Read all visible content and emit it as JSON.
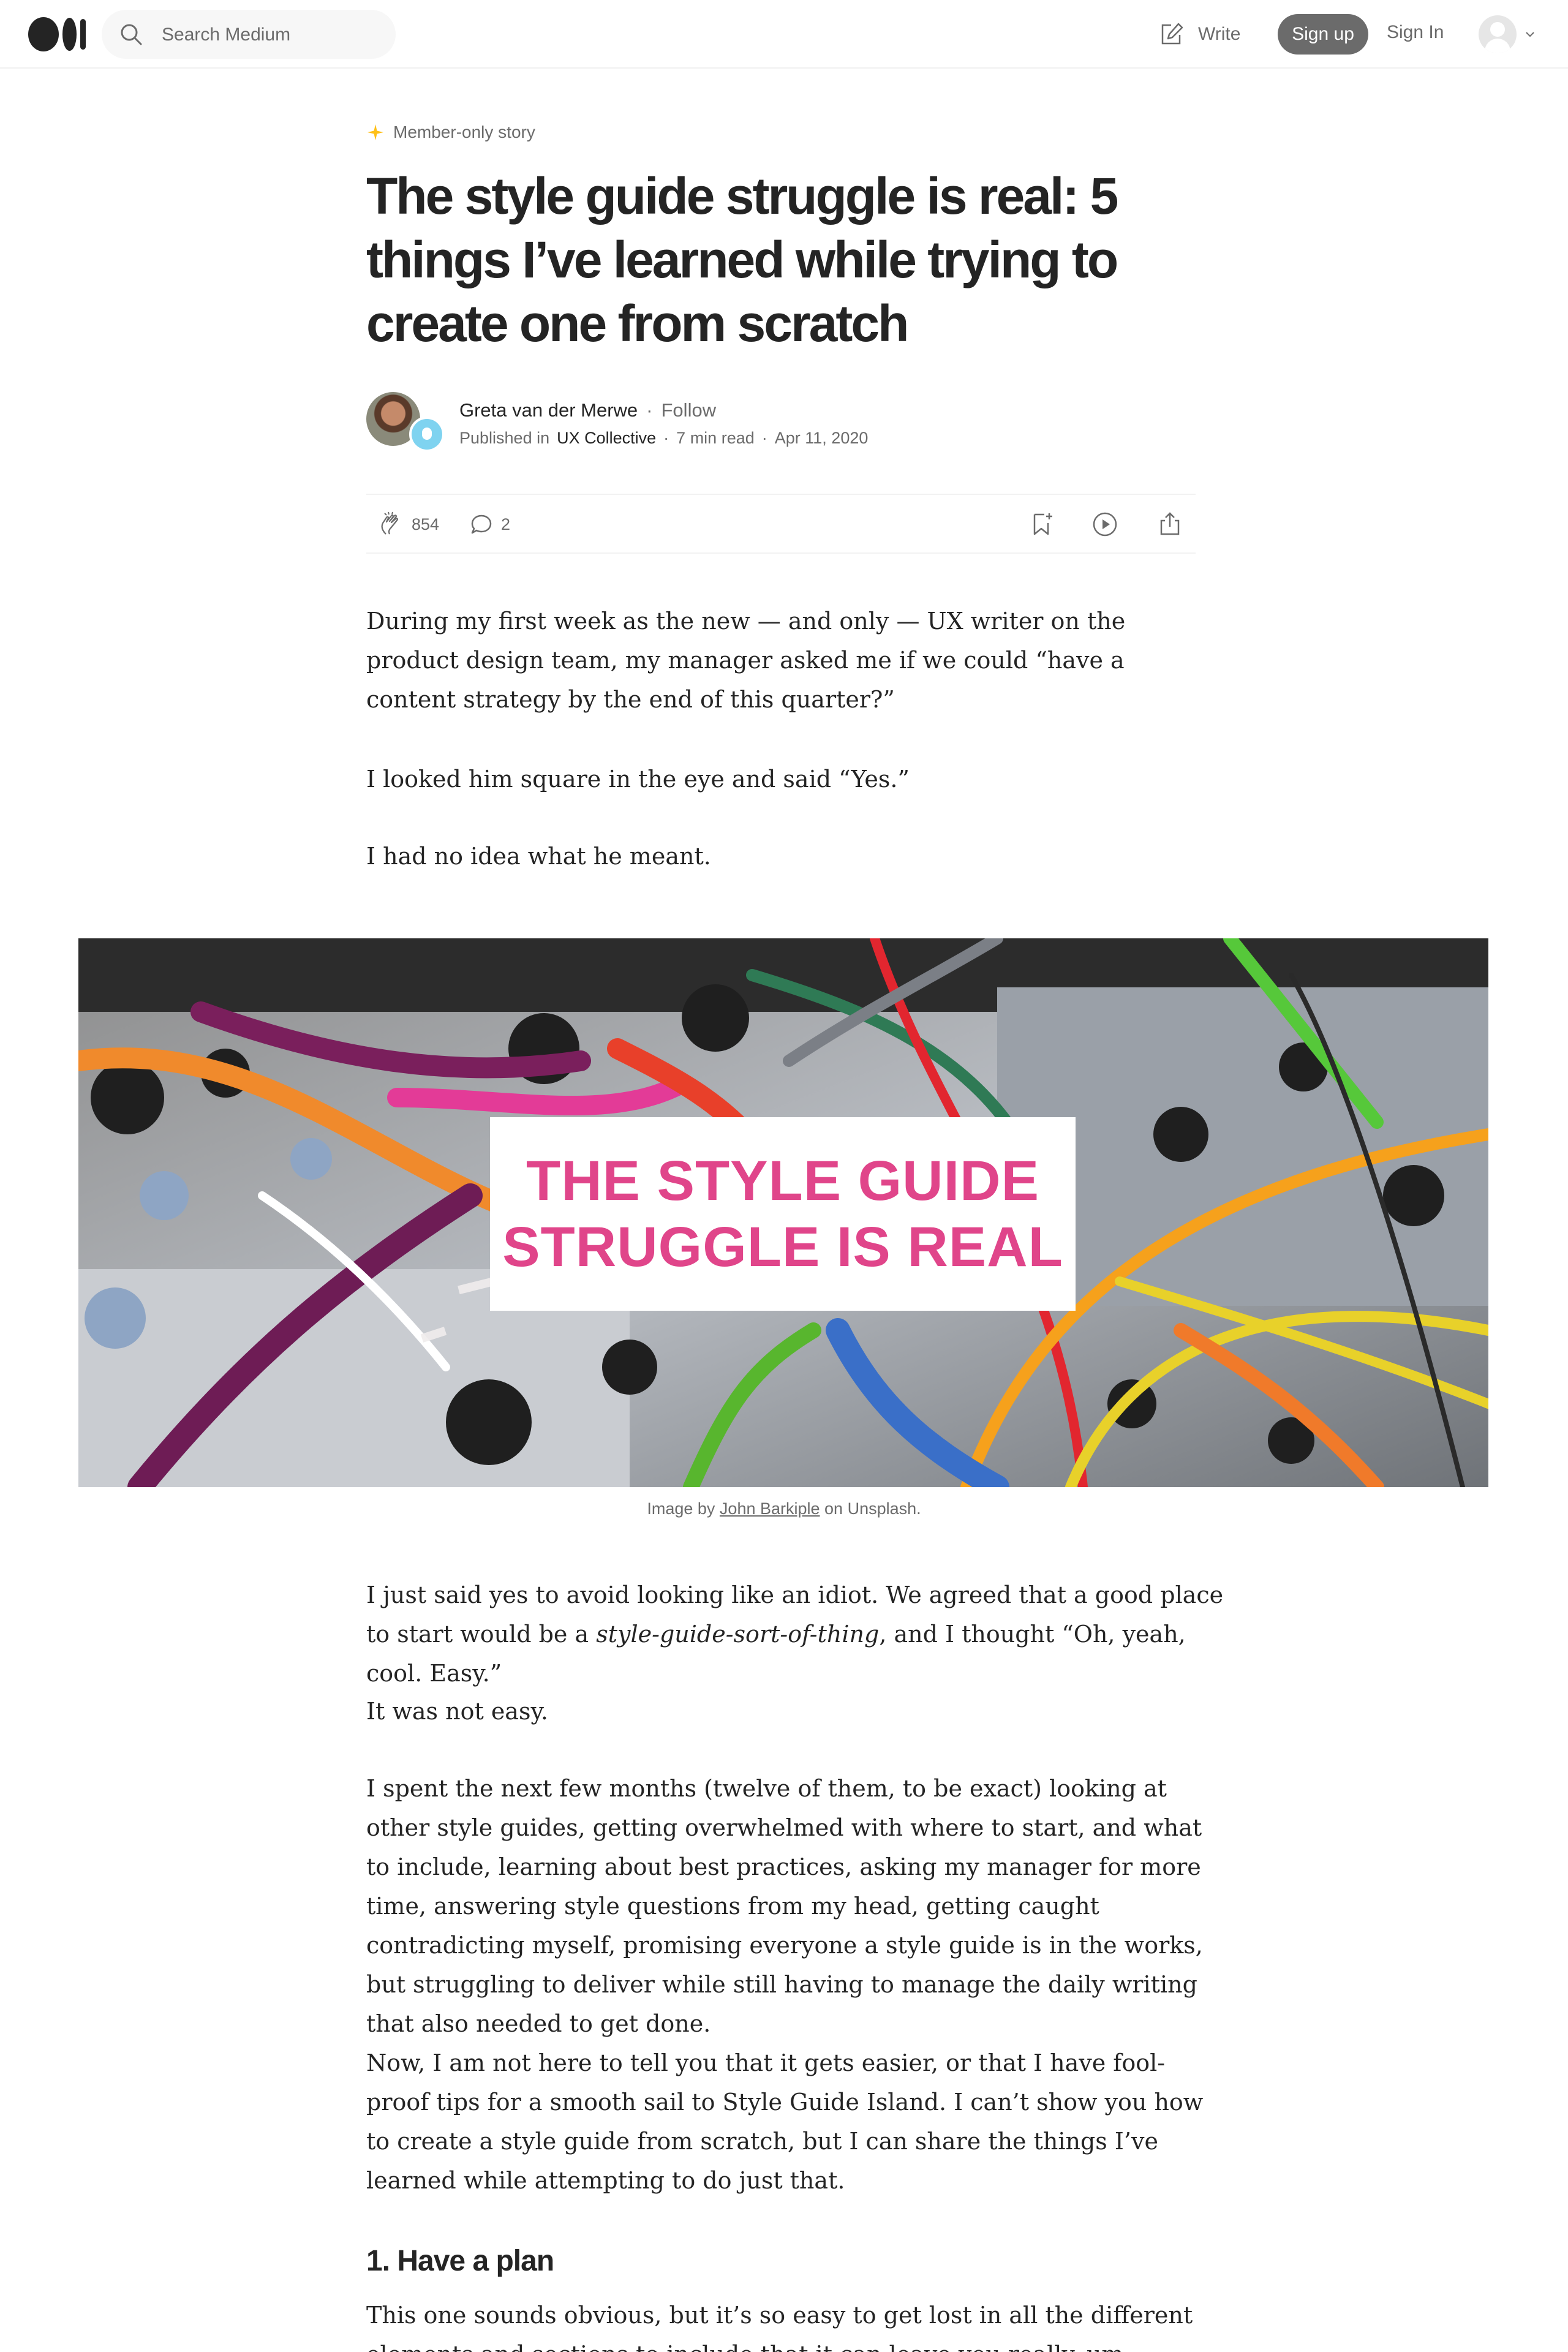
{
  "nav": {
    "search_placeholder": "Search Medium",
    "write_label": "Write",
    "signup_label": "Sign up",
    "signin_label": "Sign In"
  },
  "article": {
    "member_label": "Member-only story",
    "title": "The style guide struggle is real: 5 things I’ve learned while trying to create one from scratch",
    "author": "Greta van der Merwe",
    "follow_label": "Follow",
    "published_in_label": "Published in",
    "publication": "UX Collective",
    "read_time": "7 min read",
    "date": "Apr 11, 2020",
    "claps": "854",
    "responses": "2",
    "paragraphs": {
      "p1": "During my first week as the new — and only — UX writer on the product design team, my manager asked me if we could “have a content strategy by the end of this quarter?”",
      "p2": "I looked him square in the eye and said “Yes.”",
      "p3": "I had no idea what he meant.",
      "p4_a": "I just said yes to avoid looking like an idiot. We agreed that a good place to start would be a ",
      "p4_em": "style-guide-sort-of-thing",
      "p4_b": ", and I thought “Oh, yeah, cool. Easy.”",
      "p5": "It was not easy.",
      "p6": "I spent the next few months (twelve of them, to be exact) looking at other style guides, getting overwhelmed with where to start, and what to include, learning about best practices, asking my manager for more time, answering style questions from my head, getting caught contradicting myself, promising everyone a style guide is in the works, but struggling to deliver while still having to manage the daily writing that also needed to get done.",
      "p7": "Now, I am not here to tell you that it gets easier, or that I have fool-proof tips for a smooth sail to Style Guide Island. I can’t show you how to create a style guide from scratch, but I can share the things I’ve learned while attempting to do just that.",
      "h2": "1. Have a plan",
      "p8": "This one sounds obvious, but it’s so easy to get lost in all the different elements and sections to include that it can leave you really, um... well..."
    },
    "hero": {
      "line1": "THE STYLE GUIDE",
      "line2": "STRUGGLE IS REAL",
      "accent": "#e0458a"
    },
    "caption": {
      "prefix": "Image by ",
      "credit": "John Barkiple",
      "suffix": " on Unsplash."
    }
  },
  "icons": [
    "medium-logo-icon",
    "search-icon",
    "write-icon",
    "user-avatar-icon",
    "chevron-down-icon",
    "sparkle-icon",
    "clap-icon",
    "response-icon",
    "bookmark-icon",
    "listen-icon",
    "share-icon"
  ]
}
